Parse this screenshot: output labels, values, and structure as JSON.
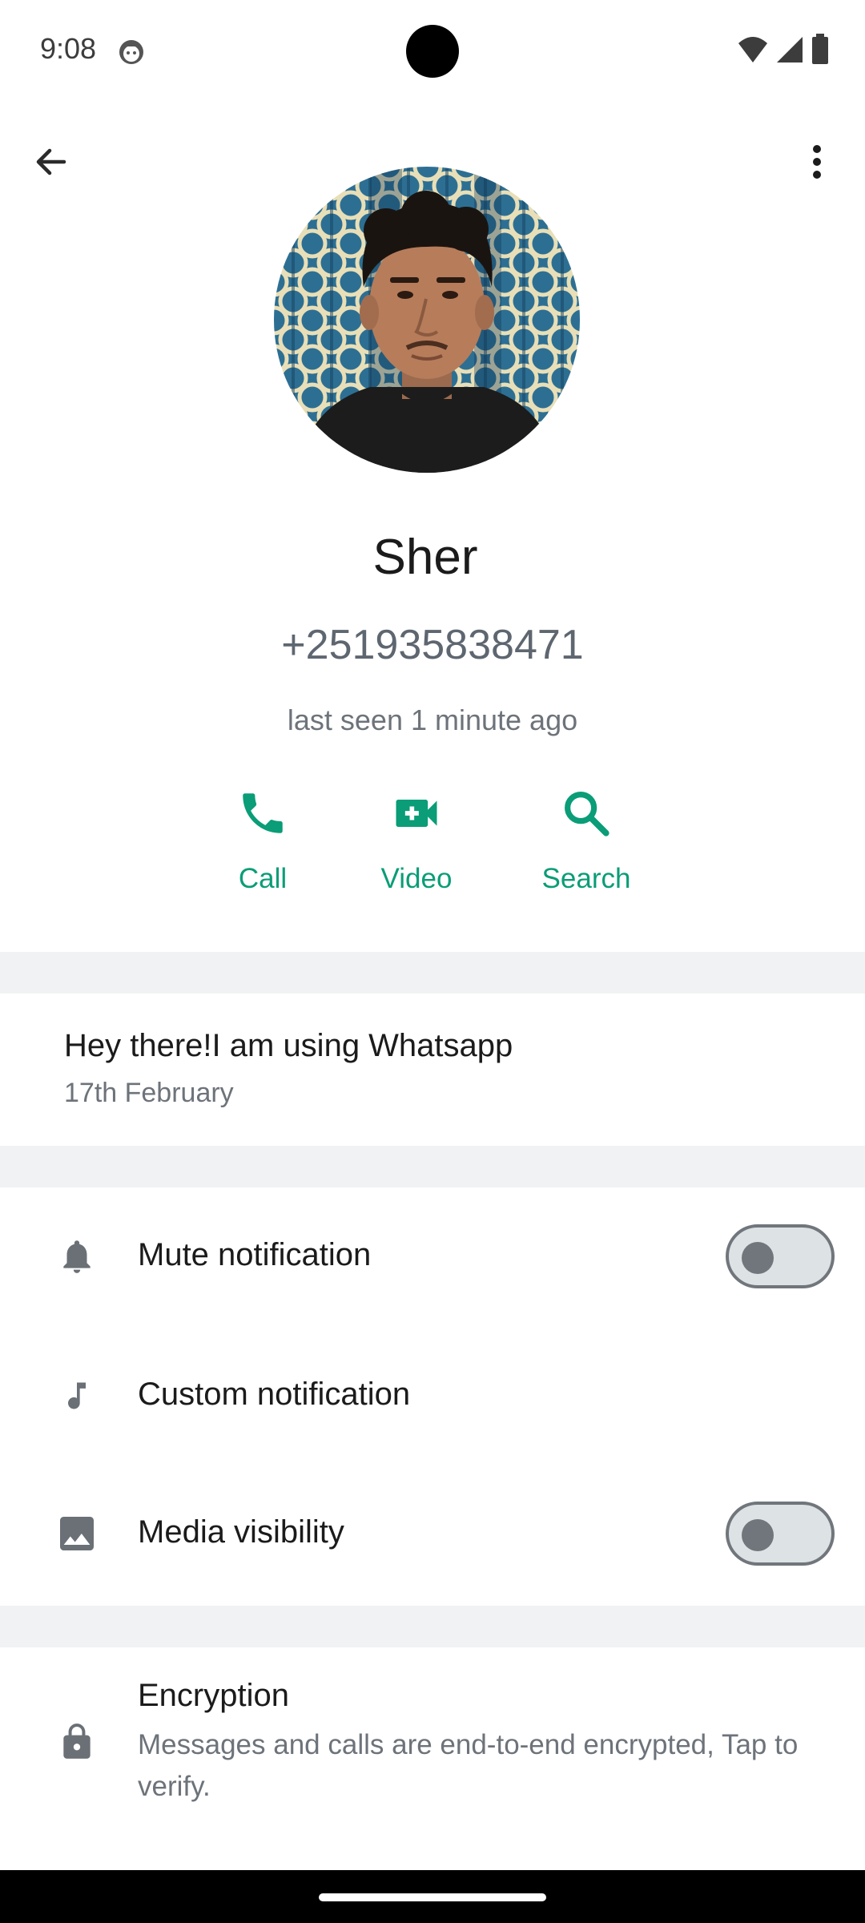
{
  "status_bar": {
    "time": "9:08",
    "icons": [
      "notification-face-icon",
      "wifi-icon",
      "signal-icon",
      "battery-icon"
    ]
  },
  "top_bar": {
    "back_icon": "arrow-back-icon",
    "more_icon": "more-vert-icon"
  },
  "contact": {
    "name": "Sher",
    "phone": "+251935838471",
    "last_seen": "last seen 1 minute ago"
  },
  "actions": [
    {
      "label": "Call",
      "icon": "phone-icon"
    },
    {
      "label": "Video",
      "icon": "video-call-icon"
    },
    {
      "label": "Search",
      "icon": "search-icon"
    }
  ],
  "about": {
    "text": "Hey there!I am using Whatsapp",
    "date": "17th February"
  },
  "settings": [
    {
      "label": "Mute notification",
      "icon": "bell-icon",
      "toggle": false
    },
    {
      "label": "Custom notification",
      "icon": "music-note-icon"
    },
    {
      "label": "Media visibility",
      "icon": "image-icon",
      "toggle": false
    }
  ],
  "encryption": {
    "title": "Encryption",
    "description": "Messages and calls are end-to-end encrypted, Tap to verify.",
    "icon": "lock-icon"
  },
  "colors": {
    "accent": "#0a9d77",
    "band": "#f1f2f3",
    "text_primary": "#1b1b1b",
    "text_secondary": "#6d737a"
  }
}
